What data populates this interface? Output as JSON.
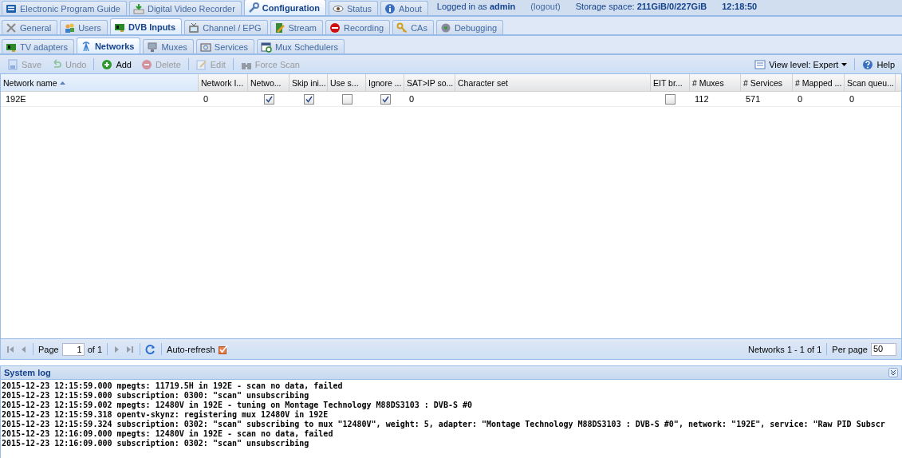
{
  "main_tabs": [
    {
      "label": "Electronic Program Guide",
      "selected": false
    },
    {
      "label": "Digital Video Recorder",
      "selected": false
    },
    {
      "label": "Configuration",
      "selected": true
    },
    {
      "label": "Status",
      "selected": false
    },
    {
      "label": "About",
      "selected": false
    }
  ],
  "header_info": [
    {
      "kind": "text",
      "text": "Logged in as **admin**"
    },
    {
      "kind": "link",
      "text": "(logout)"
    },
    {
      "kind": "text",
      "text": "Storage space: **211GiB/0/227GiB**"
    },
    {
      "kind": "text",
      "text": "**12:18:50**"
    }
  ],
  "config_tabs": [
    {
      "label": "General",
      "selected": false
    },
    {
      "label": "Users",
      "selected": false
    },
    {
      "label": "DVB Inputs",
      "selected": true
    },
    {
      "label": "Channel / EPG",
      "selected": false
    },
    {
      "label": "Stream",
      "selected": false
    },
    {
      "label": "Recording",
      "selected": false
    },
    {
      "label": "CAs",
      "selected": false
    },
    {
      "label": "Debugging",
      "selected": false
    }
  ],
  "dvb_tabs": [
    {
      "label": "TV adapters",
      "selected": false
    },
    {
      "label": "Networks",
      "selected": true
    },
    {
      "label": "Muxes",
      "selected": false
    },
    {
      "label": "Services",
      "selected": false
    },
    {
      "label": "Mux Schedulers",
      "selected": false
    }
  ],
  "toolbar": {
    "buttons": [
      {
        "label": "Save",
        "disabled": true
      },
      {
        "label": "Undo",
        "disabled": true
      },
      {
        "label": "Add",
        "disabled": false
      },
      {
        "label": "Delete",
        "disabled": true
      },
      {
        "label": "Edit",
        "disabled": true
      },
      {
        "label": "Force Scan",
        "disabled": true
      }
    ],
    "view_level": "View level: Expert",
    "help": "Help"
  },
  "table": {
    "columns": [
      {
        "label": "Network name",
        "kind": "text",
        "sorted": true
      },
      {
        "label": "Network I...",
        "kind": "text",
        "sorted": false
      },
      {
        "label": "Netwo...",
        "kind": "check",
        "sorted": false
      },
      {
        "label": "Skip ini...",
        "kind": "check",
        "sorted": false
      },
      {
        "label": "Use s...",
        "kind": "check",
        "sorted": false
      },
      {
        "label": "Ignore ...",
        "kind": "check",
        "sorted": false
      },
      {
        "label": "SAT>IP so...",
        "kind": "text",
        "sorted": false
      },
      {
        "label": "Character set",
        "kind": "text",
        "sorted": false
      },
      {
        "label": "EIT br...",
        "kind": "check",
        "sorted": false
      },
      {
        "label": "# Muxes",
        "kind": "text",
        "sorted": false
      },
      {
        "label": "# Services",
        "kind": "text",
        "sorted": false
      },
      {
        "label": "# Mapped ...",
        "kind": "text",
        "sorted": false
      },
      {
        "label": "Scan queu...",
        "kind": "text",
        "sorted": false
      }
    ],
    "rows": [
      {
        "cells": [
          {
            "text": "192E"
          },
          {
            "text": "0"
          },
          {
            "checked": true
          },
          {
            "checked": true
          },
          {
            "checked": false
          },
          {
            "checked": true
          },
          {
            "text": "0"
          },
          {},
          {
            "checked": false
          },
          {
            "text": "112"
          },
          {
            "text": "571"
          },
          {
            "text": "0"
          },
          {
            "text": "0"
          }
        ]
      }
    ]
  },
  "paging": {
    "page_label": "Page",
    "page": "1",
    "of": "of 1",
    "auto_refresh_label": "Auto-refresh",
    "auto_refresh": true,
    "summary": "Networks 1 - 1 of 1",
    "per_page_label": "Per page",
    "per_page": "50"
  },
  "system_log": {
    "title": "System log",
    "lines": [
      "2015-12-23 12:15:59.000 mpegts: 11719.5H in 192E - scan no data, failed",
      "2015-12-23 12:15:59.000 subscription: 0300: \"scan\" unsubscribing",
      "2015-12-23 12:15:59.002 mpegts: 12480V in 192E - tuning on Montage Technology M88DS3103 : DVB-S #0",
      "2015-12-23 12:15:59.318 opentv-skynz: registering mux 12480V in 192E",
      "2015-12-23 12:15:59.324 subscription: 0302: \"scan\" subscribing to mux \"12480V\", weight: 5, adapter: \"Montage Technology M88DS3103 : DVB-S #0\", network: \"192E\", service: \"Raw PID Subscr",
      "2015-12-23 12:16:09.000 mpegts: 12480V in 192E - scan no data, failed",
      "2015-12-23 12:16:09.000 subscription: 0302: \"scan\" unsubscribing"
    ]
  }
}
